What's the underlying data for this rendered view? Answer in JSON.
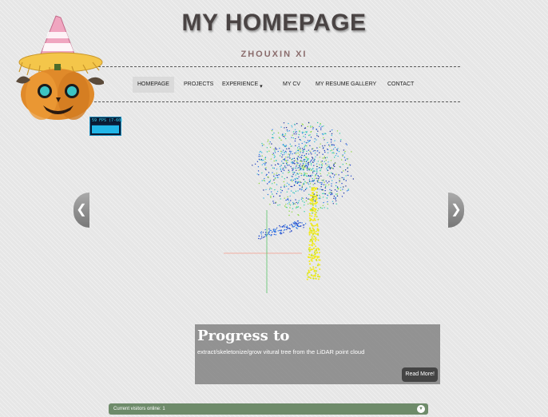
{
  "header": {
    "title": "MY HOMEPAGE",
    "subtitle": "ZHOUXIN XI"
  },
  "nav": {
    "items": [
      {
        "label": "HOMEPAGE"
      },
      {
        "label": "PROJECTS"
      },
      {
        "label": "EXPERIENCE"
      },
      {
        "label": "MY CV"
      },
      {
        "label": "MY RESUME"
      },
      {
        "label": "GALLERY"
      },
      {
        "label": "CONTACT"
      }
    ],
    "active": "HOMEPAGE"
  },
  "fps": {
    "label": "59 FPS (7-60)"
  },
  "slider": {
    "caption_title": "Progress to",
    "caption_text": "extract/skeletonize/grow vitural tree from the LiDAR point cloud",
    "read_more": "Read More!",
    "prev_icon": "chevron-left-icon",
    "next_icon": "chevron-right-icon"
  },
  "footer": {
    "visitors_label": "Current visitors online:",
    "visitors_count": "1"
  },
  "colors": {
    "background": "#e6e6e6",
    "title": "#4a4444",
    "subtitle": "#8a6c6c",
    "visitor_bar": "#6e8b6a",
    "caption_bg": "#6e6e6e"
  }
}
